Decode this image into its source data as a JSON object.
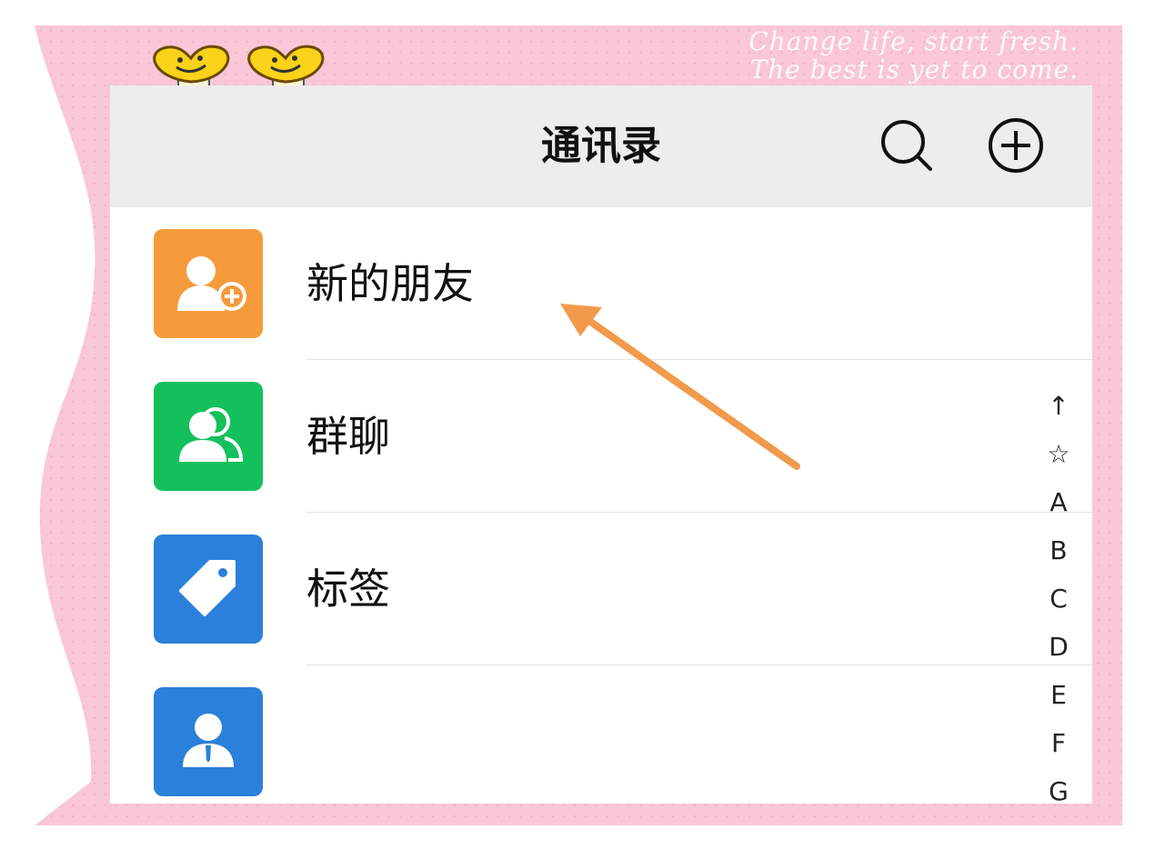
{
  "decoration": {
    "line1": "Change life, start fresh.",
    "line2": "The best is yet to come."
  },
  "header": {
    "title": "通讯录",
    "search_icon": "search-icon",
    "add_icon": "add-circle-icon"
  },
  "contacts_menu": [
    {
      "label": "新的朋友",
      "icon": "new-friend-icon",
      "color": "#f69b3b"
    },
    {
      "label": "群聊",
      "icon": "group-chat-icon",
      "color": "#14c05c"
    },
    {
      "label": "标签",
      "icon": "tag-icon",
      "color": "#2a80da"
    },
    {
      "label": "",
      "icon": "official-account-icon",
      "color": "#2a80da"
    }
  ],
  "index_bar": [
    "↑",
    "☆",
    "A",
    "B",
    "C",
    "D",
    "E",
    "F",
    "G"
  ],
  "annotation": {
    "arrow_color": "#f19a4b"
  }
}
